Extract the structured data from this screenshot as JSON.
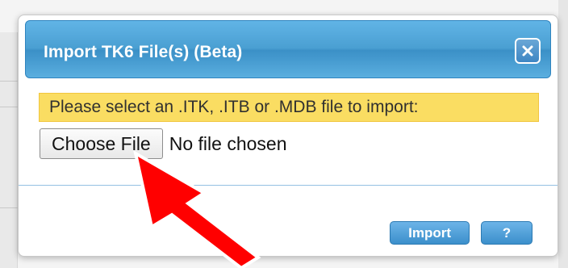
{
  "dialog": {
    "title": "Import TK6 File(s) (Beta)",
    "close_icon": "close-icon",
    "notice": "Please select an .ITK, .ITB or .MDB file to import:",
    "file_input": {
      "button_label": "Choose File",
      "status": "No file chosen"
    },
    "buttons": {
      "import": "Import",
      "help": "?"
    }
  },
  "colors": {
    "title_bar": "#4a9fd2",
    "notice_background": "#fadd62",
    "action_button": "#3b8fcb",
    "arrow": "#ff0000"
  },
  "annotation": {
    "icon": "red-arrow-icon"
  }
}
